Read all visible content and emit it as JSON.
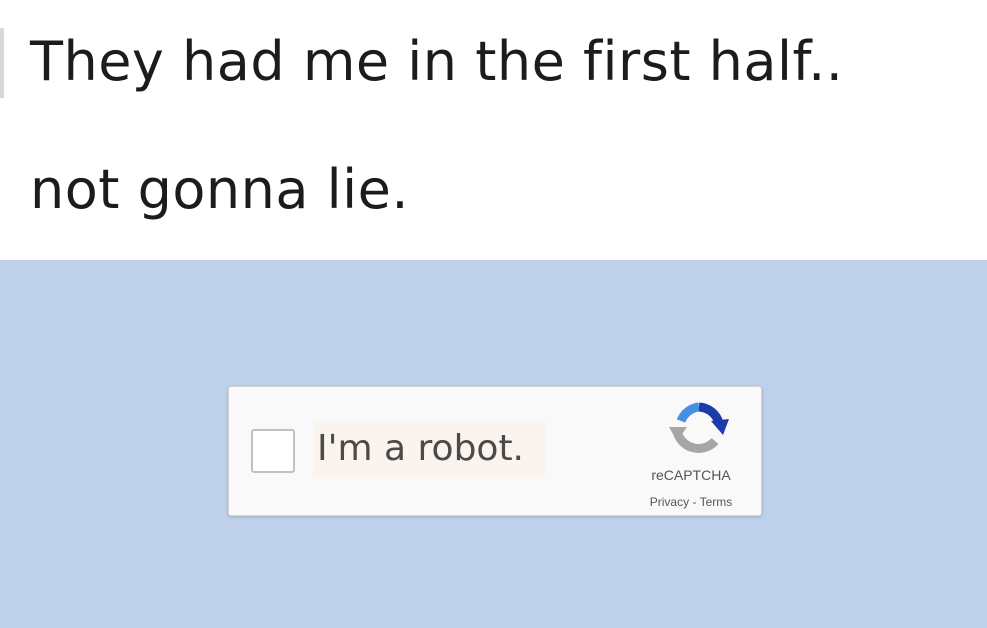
{
  "caption": {
    "line1": "They had me in the first half..",
    "line2": "not gonna lie."
  },
  "captcha": {
    "checkbox_label": "I'm a robot.",
    "brand": "reCAPTCHA",
    "privacy_link": "Privacy",
    "separator": " - ",
    "terms_link": "Terms",
    "logo_icon": "recaptcha-logo-icon",
    "colors": {
      "panel_background": "#bfd1ea",
      "logo_blue": "#1c3aa9",
      "logo_light_blue": "#4a90e2",
      "logo_gray": "#a6a6a6"
    }
  }
}
